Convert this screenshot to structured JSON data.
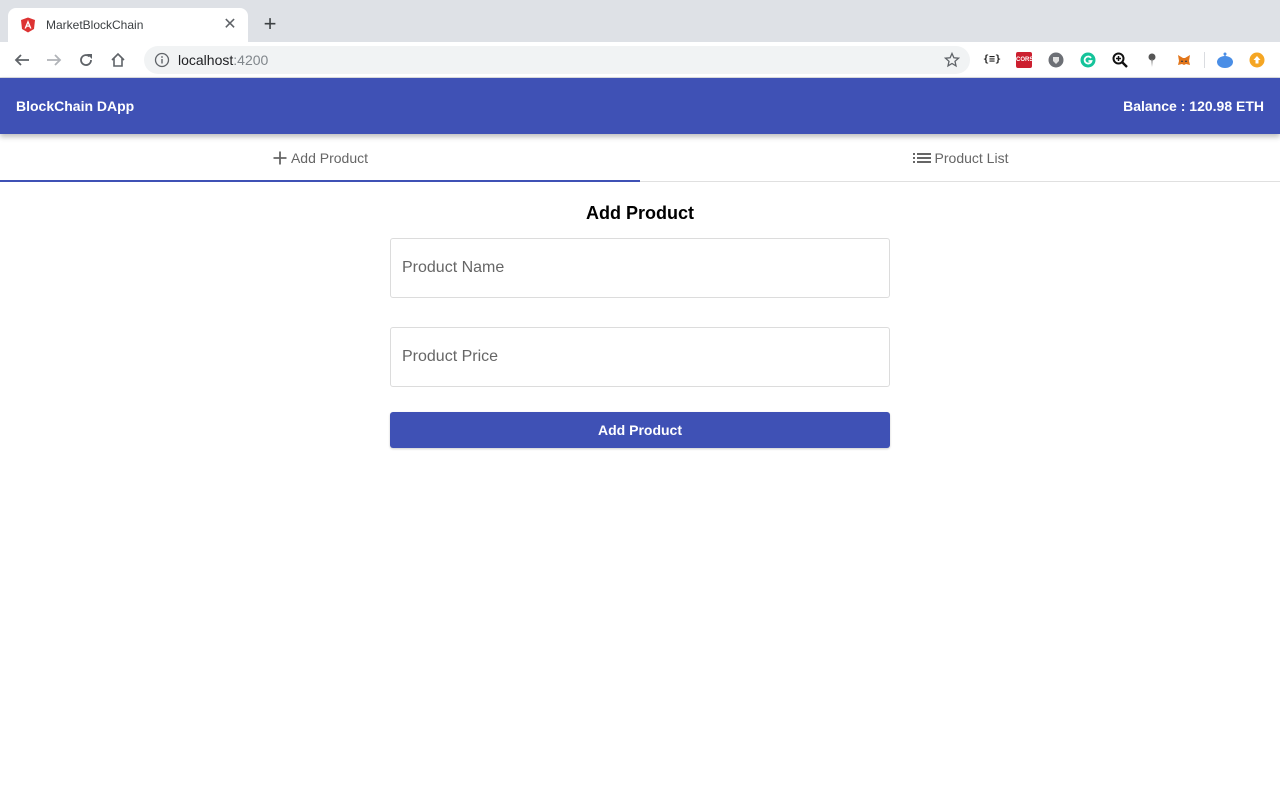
{
  "browser": {
    "tab": {
      "title": "MarketBlockChain",
      "favicon": "angular-icon"
    },
    "url": {
      "host": "localhost",
      "port": ":4200"
    },
    "extensions": [
      "json-viewer-icon",
      "cors-icon",
      "privacy-badger-icon",
      "grammarly-icon",
      "zoom-icon",
      "map-pin-icon",
      "metamask-icon",
      "blob-extension-icon",
      "upload-extension-icon"
    ],
    "cors_label": "CORS"
  },
  "app": {
    "title": "BlockChain DApp",
    "balance": "Balance : 120.98 ETH",
    "brand_color": "#3f51b5"
  },
  "tabs": [
    {
      "label": "Add Product",
      "icon": "plus-icon",
      "active": true
    },
    {
      "label": "Product List",
      "icon": "list-icon",
      "active": false
    }
  ],
  "form": {
    "title": "Add Product",
    "name_placeholder": "Product Name",
    "name_value": "",
    "price_placeholder": "Product Price",
    "price_value": "",
    "submit_label": "Add Product"
  }
}
